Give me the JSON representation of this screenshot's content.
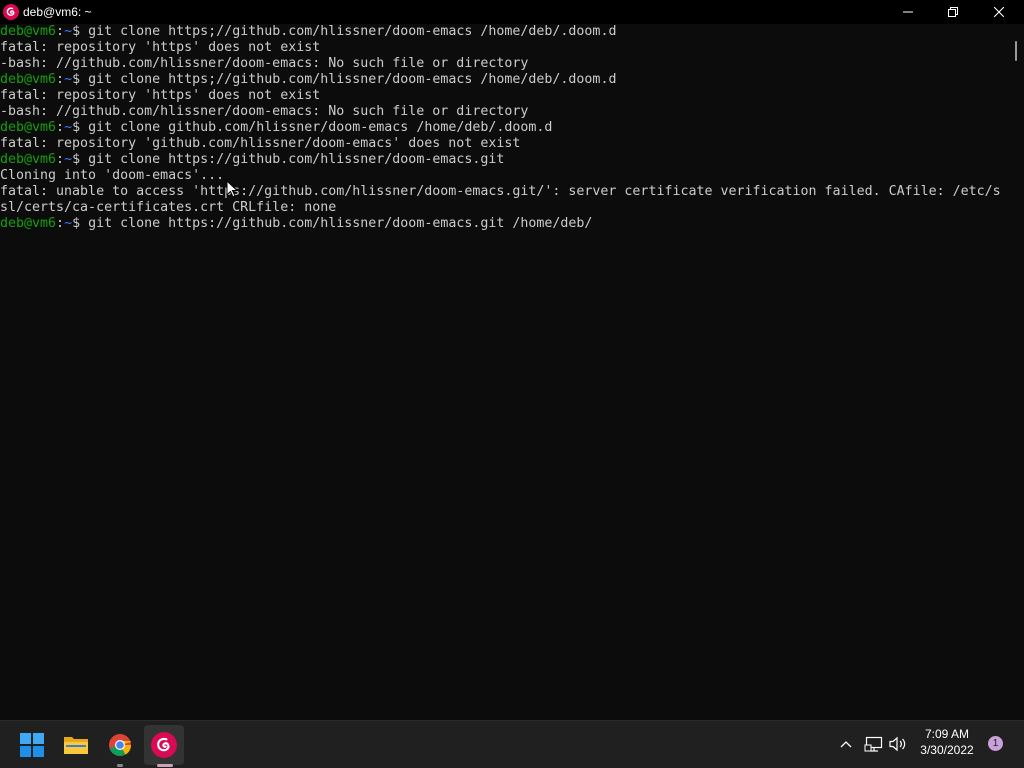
{
  "window": {
    "title": "deb@vm6: ~",
    "icon": "debian-swirl-icon"
  },
  "terminal": {
    "lines": [
      {
        "type": "cmd",
        "user": "deb@vm6",
        "path": "~",
        "cmd": "git clone https;//github.com/hlissner/doom-emacs /home/deb/.doom.d"
      },
      {
        "type": "out",
        "text": "fatal: repository 'https' does not exist"
      },
      {
        "type": "out",
        "text": "-bash: //github.com/hlissner/doom-emacs: No such file or directory"
      },
      {
        "type": "cmd",
        "user": "deb@vm6",
        "path": "~",
        "cmd": "git clone https;//github.com/hlissner/doom-emacs /home/deb/.doom.d"
      },
      {
        "type": "out",
        "text": "fatal: repository 'https' does not exist"
      },
      {
        "type": "out",
        "text": "-bash: //github.com/hlissner/doom-emacs: No such file or directory"
      },
      {
        "type": "cmd",
        "user": "deb@vm6",
        "path": "~",
        "cmd": "git clone github.com/hlissner/doom-emacs /home/deb/.doom.d"
      },
      {
        "type": "out",
        "text": "fatal: repository 'github.com/hlissner/doom-emacs' does not exist"
      },
      {
        "type": "cmd",
        "user": "deb@vm6",
        "path": "~",
        "cmd": "git clone https://github.com/hlissner/doom-emacs.git"
      },
      {
        "type": "out",
        "text": "Cloning into 'doom-emacs'..."
      },
      {
        "type": "out",
        "text": "fatal: unable to access 'https://github.com/hlissner/doom-emacs.git/': server certificate verification failed. CAfile: /etc/s"
      },
      {
        "type": "out",
        "text": "sl/certs/ca-certificates.crt CRLfile: none"
      },
      {
        "type": "cmd",
        "user": "deb@vm6",
        "path": "~",
        "cmd": "git clone https://github.com/hlissner/doom-emacs.git /home/deb/"
      }
    ]
  },
  "taskbar": {
    "apps": [
      {
        "name": "start",
        "icon": "windows-logo-icon"
      },
      {
        "name": "file-explorer",
        "icon": "folder-icon"
      },
      {
        "name": "chrome",
        "icon": "chrome-icon"
      },
      {
        "name": "debian-terminal",
        "icon": "debian-swirl-icon"
      }
    ],
    "tray": {
      "time": "7:09 AM",
      "date": "3/30/2022",
      "notification_count": "1"
    }
  },
  "colors": {
    "background": "#0c0c0c",
    "text": "#cccccc",
    "prompt_user": "#13a10e",
    "prompt_path": "#3b78ff",
    "taskbar": "#202020"
  }
}
